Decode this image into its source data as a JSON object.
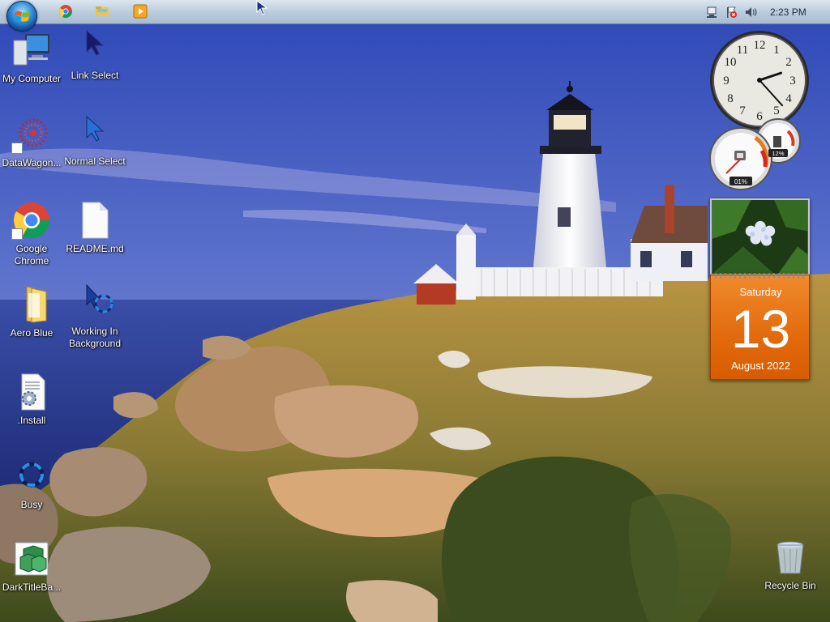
{
  "taskbar": {
    "start_icon": "windows-start-orb",
    "pinned": [
      {
        "name": "chrome-taskbar-icon"
      },
      {
        "name": "explorer-taskbar-icon"
      },
      {
        "name": "media-player-taskbar-icon"
      }
    ],
    "tray": {
      "icons": [
        "network-icon",
        "action-center-flag-icon",
        "volume-icon"
      ],
      "time": "2:23 PM"
    }
  },
  "desktop": {
    "icons": [
      {
        "label": "My Computer",
        "icon": "computer-icon"
      },
      {
        "label": "Link Select",
        "icon": "link-select-cursor-icon"
      },
      {
        "label": "DataWagon...",
        "icon": "datawagon-icon"
      },
      {
        "label": "Normal Select",
        "icon": "normal-select-cursor-icon"
      },
      {
        "label": "Google Chrome",
        "icon": "chrome-icon"
      },
      {
        "label": "README.md",
        "icon": "document-icon"
      },
      {
        "label": "Aero Blue",
        "icon": "folder-icon"
      },
      {
        "label": "Working In Background",
        "icon": "working-cursor-icon"
      },
      {
        "label": ".Install",
        "icon": "install-config-icon"
      },
      {
        "label": "Busy",
        "icon": "busy-cursor-icon"
      },
      {
        "label": "DarkTitleBa...",
        "icon": "package-icon"
      },
      {
        "label": "Recycle Bin",
        "icon": "recycle-bin-icon"
      }
    ]
  },
  "gadgets": {
    "clock": {
      "hour": 2,
      "minute": 23
    },
    "cpu_meter": {
      "cpu_percent": "01%",
      "memory_percent": "12%",
      "cpu_value": 1,
      "memory_value": 12
    },
    "calendar": {
      "weekday": "Saturday",
      "day": "13",
      "month_year": "August 2022"
    }
  },
  "colors": {
    "calendar_orange": "#e26a0c",
    "taskbar": "#b9cadb",
    "sky": "#4a64c8"
  }
}
